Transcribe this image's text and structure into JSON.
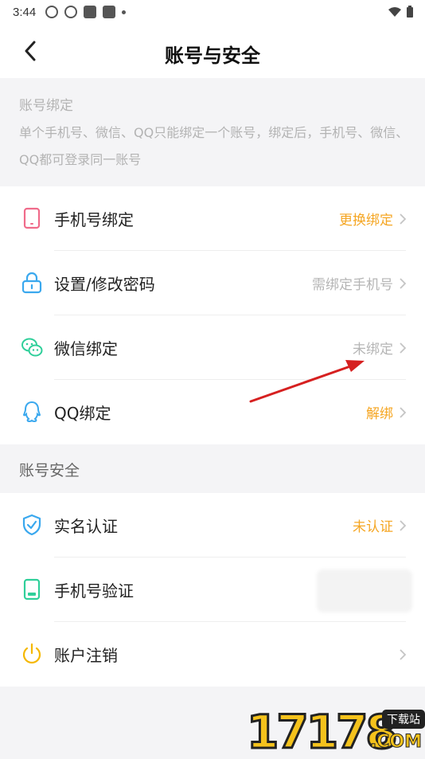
{
  "status_bar": {
    "time": "3:44"
  },
  "header": {
    "title": "账号与安全"
  },
  "binding_section": {
    "title": "账号绑定",
    "description": "单个手机号、微信、QQ只能绑定一个账号，绑定后，手机号、微信、QQ都可登录同一账号"
  },
  "binding_items": [
    {
      "label": "手机号绑定",
      "value": "更换绑定",
      "icon": "phone-icon",
      "value_color": "#f5a623"
    },
    {
      "label": "设置/修改密码",
      "value": "需绑定手机号",
      "icon": "lock-icon",
      "value_color": "#b5b5b5"
    },
    {
      "label": "微信绑定",
      "value": "未绑定",
      "icon": "wechat-icon",
      "value_color": "#b5b5b5"
    },
    {
      "label": "QQ绑定",
      "value": "解绑",
      "icon": "qq-icon",
      "value_color": "#f5a623"
    }
  ],
  "security_section": {
    "title": "账号安全"
  },
  "security_items": [
    {
      "label": "实名认证",
      "value": "未认证",
      "icon": "shield-check-icon",
      "value_color": "#f5a623"
    },
    {
      "label": "手机号验证",
      "value": "",
      "icon": "phone-verify-icon"
    },
    {
      "label": "账户注销",
      "value": "",
      "icon": "power-icon"
    }
  ],
  "watermark": {
    "number": "17178",
    "badge": "下载站",
    "domain": ".COM"
  },
  "colors": {
    "accent": "#f5a623",
    "muted": "#b5b5b5",
    "icon_blue": "#3aa8ee",
    "icon_green": "#2fcf9a",
    "icon_pink": "#f06b8a",
    "icon_yellow": "#f5b800",
    "annotation_arrow": "#d62020"
  }
}
